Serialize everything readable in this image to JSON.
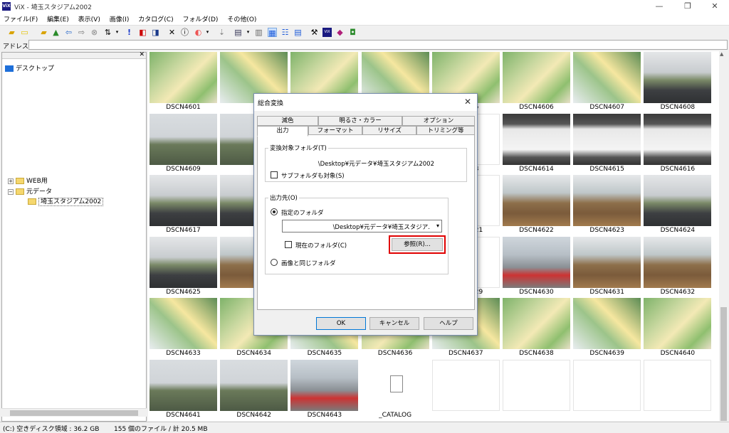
{
  "window": {
    "title": "ViX - 埼玉スタジアム2002",
    "app_icon_text": "ViX",
    "minimize": "—",
    "restore": "❐",
    "close": "✕"
  },
  "menu": [
    "ファイル(F)",
    "編集(E)",
    "表示(V)",
    "画像(I)",
    "カタログ(C)",
    "フォルダ(D)",
    "その他(O)"
  ],
  "address": {
    "label": "アドレス",
    "value": ""
  },
  "tree": {
    "desktop": "デスクトップ",
    "web": "WEB用",
    "moto": "元データ",
    "selected": "埼玉スタジアム2002",
    "close": "✕"
  },
  "thumbnails": [
    {
      "name": "DSCN4601",
      "style": "map"
    },
    {
      "name": "",
      "style": "map2"
    },
    {
      "name": "",
      "style": "map"
    },
    {
      "name": "",
      "style": "map2"
    },
    {
      "name": "",
      "style": "map"
    },
    {
      "name": "DSCN4606",
      "style": "map"
    },
    {
      "name": "DSCN4607",
      "style": "map2"
    },
    {
      "name": "DSCN4608",
      "style": "road"
    },
    {
      "name": "DSCN4609",
      "style": "sky"
    },
    {
      "name": "",
      "style": "sky"
    },
    {
      "name": "",
      "style": "blank"
    },
    {
      "name": "",
      "style": "blank"
    },
    {
      "name": "",
      "style": "blank"
    },
    {
      "name": "DSCN4614",
      "style": "sign"
    },
    {
      "name": "DSCN4615",
      "style": "sign"
    },
    {
      "name": "DSCN4616",
      "style": "sign"
    },
    {
      "name": "DSCN4617",
      "style": "road"
    },
    {
      "name": "",
      "style": "road"
    },
    {
      "name": "",
      "style": "blank"
    },
    {
      "name": "",
      "style": "blank"
    },
    {
      "name": "",
      "style": "blank"
    },
    {
      "name": "DSCN4622",
      "style": "park"
    },
    {
      "name": "DSCN4623",
      "style": "park"
    },
    {
      "name": "DSCN4624",
      "style": "road"
    },
    {
      "name": "DSCN4625",
      "style": "road"
    },
    {
      "name": "",
      "style": "park"
    },
    {
      "name": "",
      "style": "blank"
    },
    {
      "name": "",
      "style": "blank"
    },
    {
      "name": "",
      "style": "blank"
    },
    {
      "name": "DSCN4630",
      "style": "bldg"
    },
    {
      "name": "DSCN4631",
      "style": "park"
    },
    {
      "name": "DSCN4632",
      "style": "park"
    },
    {
      "name": "DSCN4633",
      "style": "map2"
    },
    {
      "name": "DSCN4634",
      "style": "map"
    },
    {
      "name": "DSCN4635",
      "style": "map2"
    },
    {
      "name": "DSCN4636",
      "style": "map"
    },
    {
      "name": "DSCN4637",
      "style": "map2"
    },
    {
      "name": "DSCN4638",
      "style": "map"
    },
    {
      "name": "DSCN4639",
      "style": "map2"
    },
    {
      "name": "DSCN4640",
      "style": "map"
    },
    {
      "name": "DSCN4641",
      "style": "sky"
    },
    {
      "name": "DSCN4642",
      "style": "sky"
    },
    {
      "name": "DSCN4643",
      "style": "bldg"
    },
    {
      "name": "_CATALOG",
      "style": "doc"
    },
    {
      "name": "",
      "style": "blank"
    },
    {
      "name": "",
      "style": "blank"
    },
    {
      "name": "",
      "style": "blank"
    },
    {
      "name": "",
      "style": "blank"
    }
  ],
  "partial_captions": [
    "5",
    "3",
    "21",
    "29"
  ],
  "status": {
    "disk": "(C:) 空きディスク領域 : 36.2 GB",
    "files": "155 個のファイル / 計 20.5 MB"
  },
  "dialog": {
    "title": "総合変換",
    "close": "✕",
    "tabs_back": [
      "減色",
      "明るさ・カラー",
      "オプション"
    ],
    "tabs_front": [
      "出力",
      "フォーマット",
      "リサイズ",
      "トリミング等"
    ],
    "source_group": "変換対象フォルダ(T)",
    "source_path": "\\Desktop¥元データ¥埼玉スタジアム2002",
    "subfolder_check": "サブフォルダも対象(S)",
    "dest_group": "出力先(O)",
    "radio_specified": "指定のフォルダ",
    "dest_combo": "\\Desktop¥元データ¥埼玉スタジア.",
    "current_folder_check": "現在のフォルダ(C)",
    "browse_button": "参照(R)...",
    "radio_same": "画像と同じフォルダ",
    "ok": "OK",
    "cancel": "キャンセル",
    "help": "ヘルプ"
  }
}
